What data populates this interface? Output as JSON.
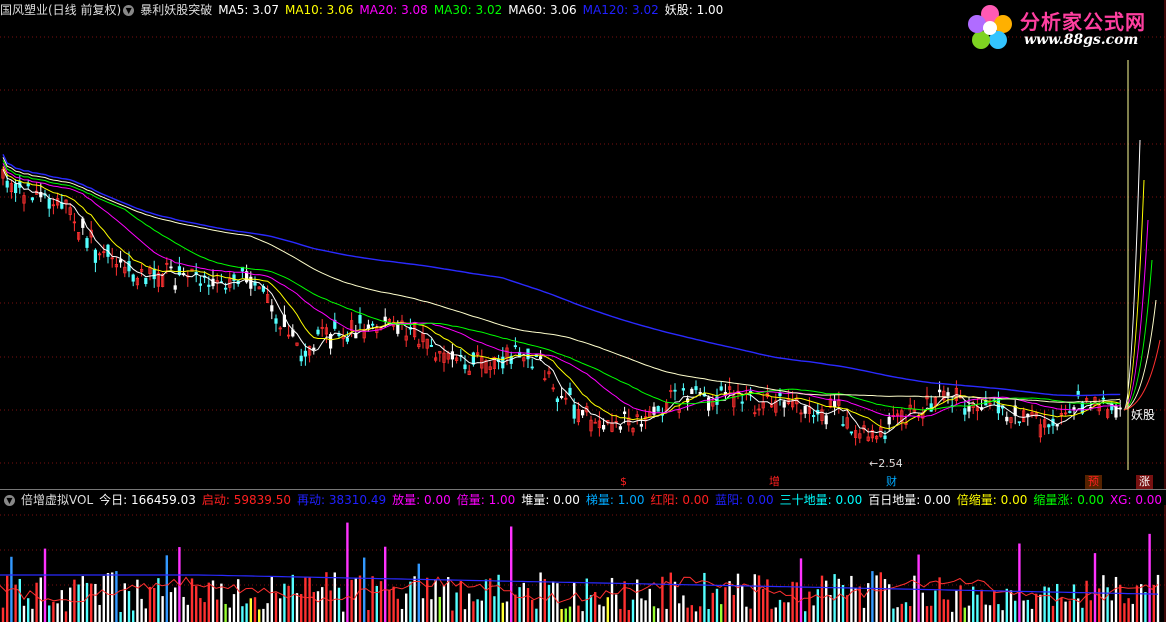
{
  "header": {
    "stock": "国风塑业(日线 前复权)",
    "indicator": "暴利妖股突破",
    "ma": [
      {
        "label": "MA5: 3.07",
        "color": "#ffffff"
      },
      {
        "label": "MA10: 3.06",
        "color": "#ffff00"
      },
      {
        "label": "MA20: 3.08",
        "color": "#ff00ff"
      },
      {
        "label": "MA30: 3.02",
        "color": "#00ff00"
      },
      {
        "label": "MA60: 3.06",
        "color": "#ffffff"
      },
      {
        "label": "MA120: 3.02",
        "color": "#2020ff"
      },
      {
        "label": "妖股: 1.00",
        "color": "#ffffff"
      }
    ]
  },
  "logo": {
    "name": "分析家公式网",
    "url": "www.88gs.com"
  },
  "chart_annotations": {
    "low_price": "2.54",
    "signal_label": "妖股",
    "markers": [
      {
        "label": "$",
        "color": "#ff2020"
      },
      {
        "label": "增",
        "color": "#ff2020"
      },
      {
        "label": "财",
        "color": "#00aaff"
      },
      {
        "label": "预",
        "color": "#ff2020"
      },
      {
        "label": "涨",
        "color": "#ff2020"
      }
    ]
  },
  "sub_header": {
    "indicator": "倍增虚拟VOL",
    "items": [
      {
        "label": "今日: 166459.03",
        "color": "#ffffff"
      },
      {
        "label": "启动: 59839.50",
        "color": "#ff2020"
      },
      {
        "label": "再动: 38310.49",
        "color": "#2020ff"
      },
      {
        "label": "放量: 0.00",
        "color": "#ff00ff"
      },
      {
        "label": "倍量: 1.00",
        "color": "#ff00ff"
      },
      {
        "label": "堆量: 0.00",
        "color": "#ffffff"
      },
      {
        "label": "梯量: 1.00",
        "color": "#00aaff"
      },
      {
        "label": "红阳: 0.00",
        "color": "#ff2020"
      },
      {
        "label": "蓝阳: 0.00",
        "color": "#2020ff"
      },
      {
        "label": "三十地量: 0.00",
        "color": "#00ffff"
      },
      {
        "label": "百日地量: 0.00",
        "color": "#ffffff"
      },
      {
        "label": "倍缩量: 0.00",
        "color": "#ffff00"
      },
      {
        "label": "缩量涨: 0.00",
        "color": "#00ff00"
      },
      {
        "label": "XG: 0.00",
        "color": "#ff00ff"
      }
    ]
  }
}
